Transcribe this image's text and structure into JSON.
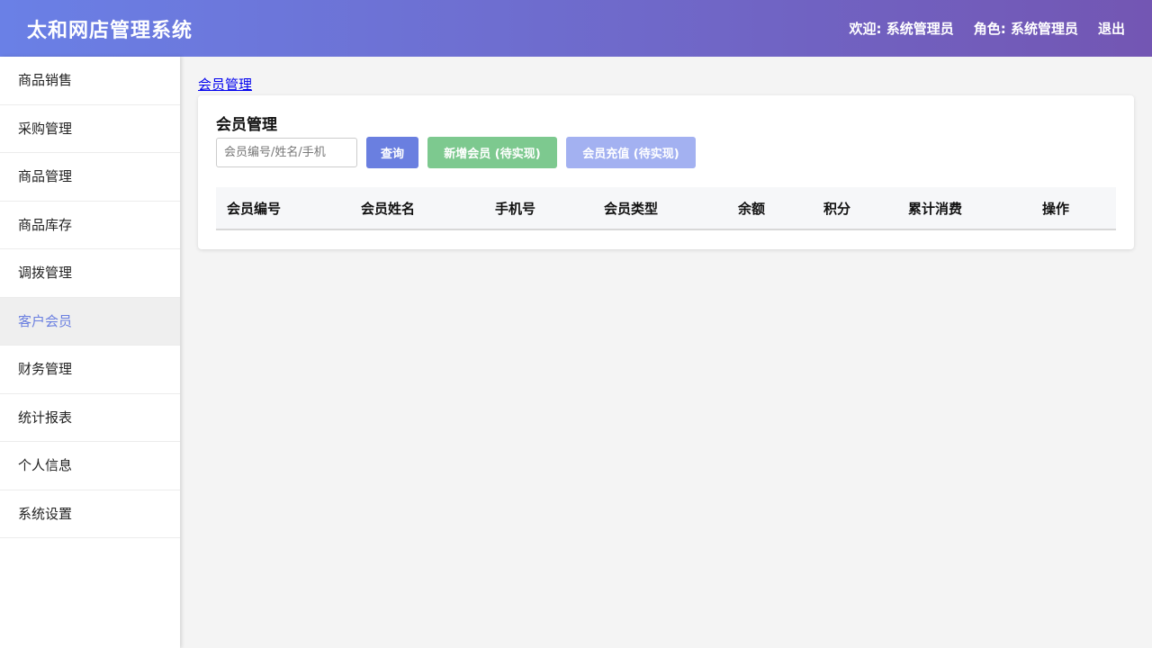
{
  "header": {
    "title": "太和网店管理系统",
    "welcome": "欢迎: 系统管理员",
    "role": "角色: 系统管理员",
    "logout": "退出"
  },
  "sidebar": {
    "items": [
      {
        "label": "商品销售"
      },
      {
        "label": "采购管理"
      },
      {
        "label": "商品管理"
      },
      {
        "label": "商品库存"
      },
      {
        "label": "调拨管理"
      },
      {
        "label": "客户会员",
        "active": true
      },
      {
        "label": "财务管理"
      },
      {
        "label": "统计报表"
      },
      {
        "label": "个人信息"
      },
      {
        "label": "系统设置"
      }
    ]
  },
  "main": {
    "breadcrumb": "会员管理",
    "card_title": "会员管理",
    "search": {
      "placeholder": "会员编号/姓名/手机",
      "value": ""
    },
    "buttons": {
      "query": "查询",
      "add": "新增会员 (待实现)",
      "recharge": "会员充值 (待实现)"
    },
    "table": {
      "columns": [
        "会员编号",
        "会员姓名",
        "手机号",
        "会员类型",
        "余额",
        "积分",
        "累计消费",
        "操作"
      ],
      "rows": []
    }
  },
  "colors": {
    "header_gradient_start": "#6a80e6",
    "header_gradient_end": "#7356b3",
    "accent": "#6a7fe0",
    "add_button": "#7dc98f",
    "recharge_button": "#a3b1f1"
  }
}
